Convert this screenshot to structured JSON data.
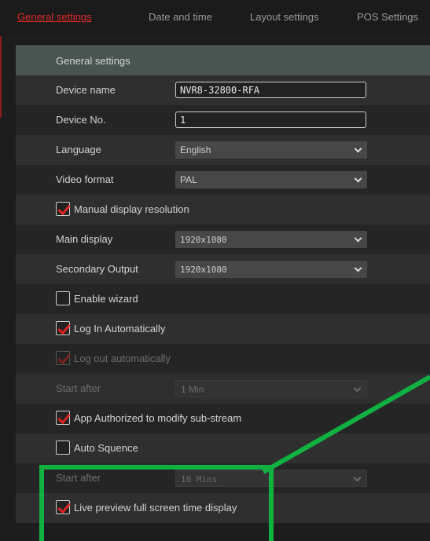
{
  "tabs": [
    {
      "label": "General settings",
      "active": true
    },
    {
      "label": "Date and time",
      "active": false
    },
    {
      "label": "Layout settings",
      "active": false
    },
    {
      "label": "POS Settings",
      "active": false
    }
  ],
  "section_title": "General settings",
  "fields": {
    "device_name": {
      "label": "Device name",
      "value": "NVR8-32800-RFA"
    },
    "device_no": {
      "label": "Device No.",
      "value": "1"
    },
    "language": {
      "label": "Language",
      "value": "English"
    },
    "video_format": {
      "label": "Video format",
      "value": "PAL"
    },
    "manual_resolution": {
      "label": "Manual display resolution",
      "checked": true
    },
    "main_display": {
      "label": "Main display",
      "value": "1920x1080"
    },
    "secondary_output": {
      "label": "Secondary Output",
      "value": "1920x1080"
    },
    "enable_wizard": {
      "label": "Enable wizard",
      "checked": false
    },
    "login_auto": {
      "label": "Log In Automatically",
      "checked": true
    },
    "logout_auto": {
      "label": "Log out automatically",
      "checked": true,
      "disabled": true
    },
    "start_after_1": {
      "label": "Start after",
      "value": "1 Min",
      "disabled": true
    },
    "app_authorized": {
      "label": "App Authorized to modify sub-stream",
      "checked": true
    },
    "auto_sequence": {
      "label": "Auto Squence",
      "checked": false
    },
    "start_after_2": {
      "label": "Start after",
      "value": "10 Mins",
      "disabled": true
    },
    "live_preview": {
      "label": "Live preview full screen time display",
      "checked": true
    }
  },
  "colors": {
    "active_tab": "#e02a2a",
    "section_header": "#485550",
    "check_mark": "#e02424",
    "highlight": "#10b041"
  }
}
